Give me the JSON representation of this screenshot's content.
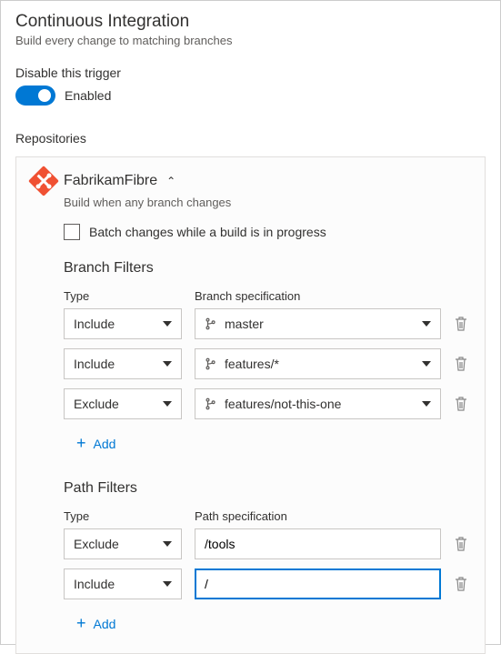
{
  "header": {
    "title": "Continuous Integration",
    "subtitle": "Build every change to matching branches"
  },
  "trigger": {
    "disable_label": "Disable this trigger",
    "state_text": "Enabled"
  },
  "repositories": {
    "label": "Repositories",
    "items": [
      {
        "name": "FabrikamFibre",
        "description": "Build when any branch changes",
        "batch_label": "Batch changes while a build is in progress",
        "branch_filters": {
          "title": "Branch Filters",
          "type_header": "Type",
          "spec_header": "Branch specification",
          "rows": [
            {
              "type": "Include",
              "spec": "master"
            },
            {
              "type": "Include",
              "spec": "features/*"
            },
            {
              "type": "Exclude",
              "spec": "features/not-this-one"
            }
          ],
          "add_label": "Add"
        },
        "path_filters": {
          "title": "Path Filters",
          "type_header": "Type",
          "spec_header": "Path specification",
          "rows": [
            {
              "type": "Exclude",
              "spec": "/tools"
            },
            {
              "type": "Include",
              "spec": "/"
            }
          ],
          "add_label": "Add"
        }
      }
    ]
  }
}
